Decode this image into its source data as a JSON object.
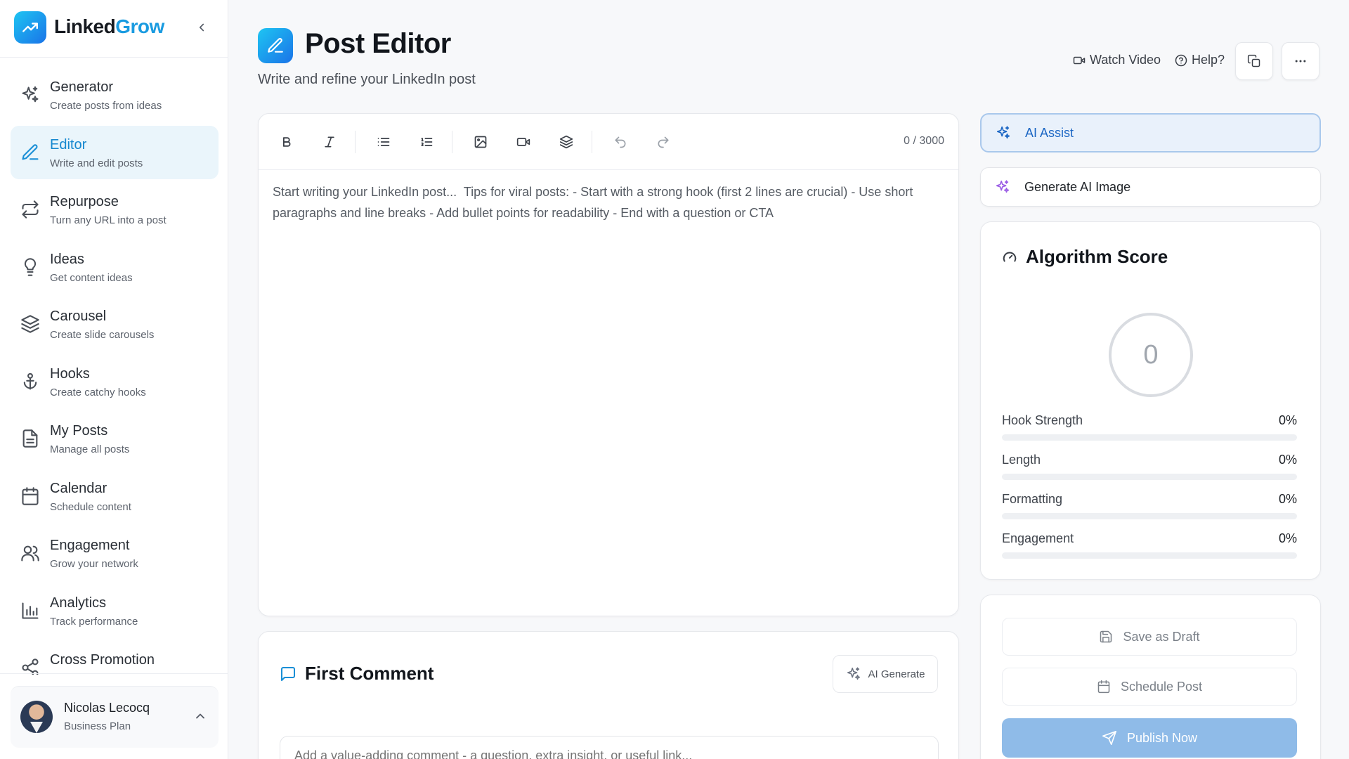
{
  "brand": {
    "name_part1": "Linked",
    "name_part2": "Grow",
    "accent_color": "#1a9be0"
  },
  "sidebar": {
    "items": [
      {
        "title": "Generator",
        "subtitle": "Create posts from ideas",
        "icon": "sparkles-icon",
        "active": false
      },
      {
        "title": "Editor",
        "subtitle": "Write and edit posts",
        "icon": "pencil-icon",
        "active": true
      },
      {
        "title": "Repurpose",
        "subtitle": "Turn any URL into a post",
        "icon": "repeat-icon",
        "active": false
      },
      {
        "title": "Ideas",
        "subtitle": "Get content ideas",
        "icon": "lightbulb-icon",
        "active": false
      },
      {
        "title": "Carousel",
        "subtitle": "Create slide carousels",
        "icon": "layers-icon",
        "active": false
      },
      {
        "title": "Hooks",
        "subtitle": "Create catchy hooks",
        "icon": "anchor-icon",
        "active": false
      },
      {
        "title": "My Posts",
        "subtitle": "Manage all posts",
        "icon": "document-icon",
        "active": false
      },
      {
        "title": "Calendar",
        "subtitle": "Schedule content",
        "icon": "calendar-icon",
        "active": false
      },
      {
        "title": "Engagement",
        "subtitle": "Grow your network",
        "icon": "users-icon",
        "active": false
      },
      {
        "title": "Analytics",
        "subtitle": "Track performance",
        "icon": "bar-chart-icon",
        "active": false
      },
      {
        "title": "Cross Promotion",
        "subtitle": "",
        "icon": "share-icon",
        "active": false
      }
    ],
    "user": {
      "name": "Nicolas Lecocq",
      "plan": "Business Plan"
    }
  },
  "header": {
    "title": "Post Editor",
    "subtitle": "Write and refine your LinkedIn post",
    "watch_video": "Watch Video",
    "help": "Help?"
  },
  "editor": {
    "char_count": "0 / 3000",
    "placeholder": "Start writing your LinkedIn post...  Tips for viral posts: - Start with a strong hook (first 2 lines are crucial) - Use short paragraphs and line breaks - Add bullet points for readability - End with a question or CTA",
    "toolbar": [
      "bold-icon",
      "italic-icon",
      "bullet-list-icon",
      "numbered-list-icon",
      "image-icon",
      "video-icon",
      "layers-icon",
      "undo-icon",
      "redo-icon"
    ]
  },
  "first_comment": {
    "title": "First Comment",
    "ai_generate": "AI Generate",
    "placeholder": "Add a value-adding comment - a question, extra insight, or useful link..."
  },
  "ai_assist": {
    "label": "AI Assist"
  },
  "generate_image": {
    "label": "Generate AI Image"
  },
  "algorithm_score": {
    "title": "Algorithm Score",
    "score": "0",
    "metrics": [
      {
        "label": "Hook Strength",
        "value": "0%",
        "fraction": 0
      },
      {
        "label": "Length",
        "value": "0%",
        "fraction": 0
      },
      {
        "label": "Formatting",
        "value": "0%",
        "fraction": 0
      },
      {
        "label": "Engagement",
        "value": "0%",
        "fraction": 0
      }
    ]
  },
  "actions": {
    "save_draft": "Save as Draft",
    "schedule": "Schedule Post",
    "publish": "Publish Now"
  }
}
